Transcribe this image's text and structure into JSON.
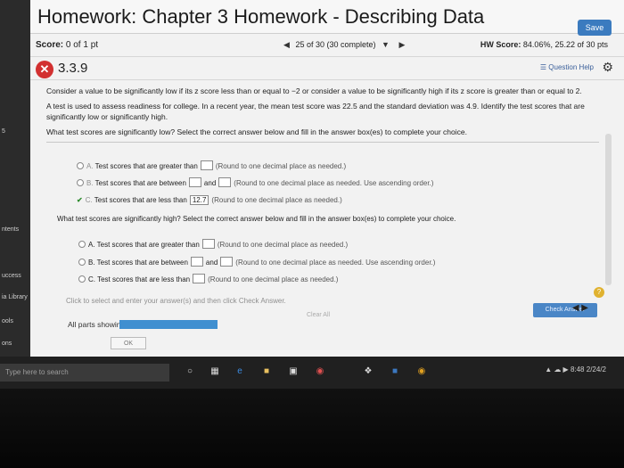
{
  "sidebar": {
    "items": [
      {
        "label": "5"
      },
      {
        "label": "ntents"
      },
      {
        "label": "uccess"
      },
      {
        "label": "ia Library"
      },
      {
        "label": "ools"
      },
      {
        "label": "ons"
      }
    ]
  },
  "header": {
    "title": "Homework: Chapter 3 Homework - Describing Data",
    "save_label": "Save"
  },
  "scorebar": {
    "score_label": "Score:",
    "score_value": "0 of 1 pt",
    "nav_text": "25 of 30 (30 complete)",
    "hw_label": "HW Score:",
    "hw_value": "84.06%, 25.22 of 30 pts"
  },
  "question": {
    "number": "3.3.9",
    "status_icon": "x-icon",
    "help_label": "Question Help",
    "intro": "Consider a value to be significantly low if its z score less than or equal to −2 or consider a value to be significantly high if its z score is greater than or equal to 2.",
    "body": "A test is used to assess readiness for college. In a recent year, the mean test score was 22.5 and the standard deviation was 4.9. Identify the test scores that are significantly low or significantly high.",
    "q1": "What test scores are significantly low? Select the correct answer below and fill in the answer box(es) to complete your choice.",
    "q1_options": [
      {
        "key": "A.",
        "text": "Test scores that are greater than",
        "hint": "(Round to one decimal place as needed.)"
      },
      {
        "key": "B.",
        "text": "Test scores that are between",
        "and": "and",
        "hint": "(Round to one decimal place as needed. Use ascending order.)"
      },
      {
        "key": "C.",
        "text": "Test scores that are less than",
        "value": "12.7",
        "hint": "(Round to one decimal place as needed.)"
      }
    ],
    "q2": "What test scores are significantly high? Select the correct answer below and fill in the answer box(es) to complete your choice.",
    "q2_options": [
      {
        "key": "A.",
        "text": "Test scores that are greater than",
        "hint": "(Round to one decimal place as needed.)"
      },
      {
        "key": "B.",
        "text": "Test scores that are between",
        "and": "and",
        "hint": "(Round to one decimal place as needed. Use ascending order.)"
      },
      {
        "key": "C.",
        "text": "Test scores that are less than",
        "hint": "(Round to one decimal place as needed.)"
      }
    ],
    "instruction": "Click to select and enter your answer(s) and then click Check Answer.",
    "parts_label": "All parts showing",
    "clear_label": "Clear All",
    "check_label": "Check Answer",
    "ok_label": "OK"
  },
  "taskbar": {
    "search_placeholder": "Type here to search",
    "tray_time": "8:48",
    "tray_year": "2/24/2"
  },
  "colors": {
    "accent": "#3b7bbf",
    "wrong": "#d23030",
    "correct": "#2d8a2d"
  }
}
